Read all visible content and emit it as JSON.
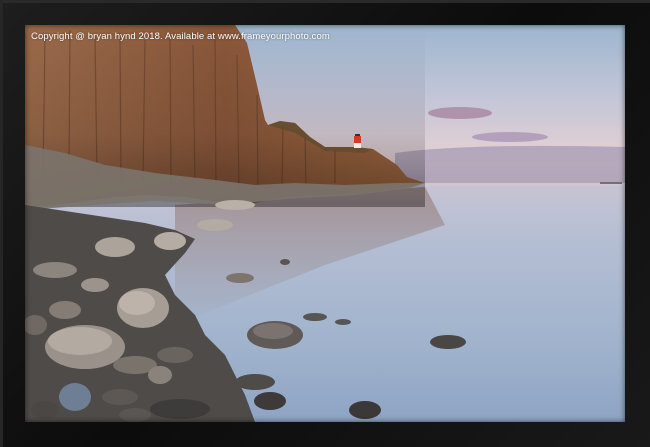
{
  "photo": {
    "watermark": "Copyright  @ bryan hynd 2018. Available at www.frameyourphoto.com"
  },
  "colors": {
    "frame": "#121212",
    "sky_top": "#9db6cf",
    "sky_horizon": "#e9d3d4",
    "water": "#a7b7cf",
    "cliff": "#8b5a3c",
    "rock": "#6e6a66",
    "lighthouse_red": "#d33a2c"
  }
}
